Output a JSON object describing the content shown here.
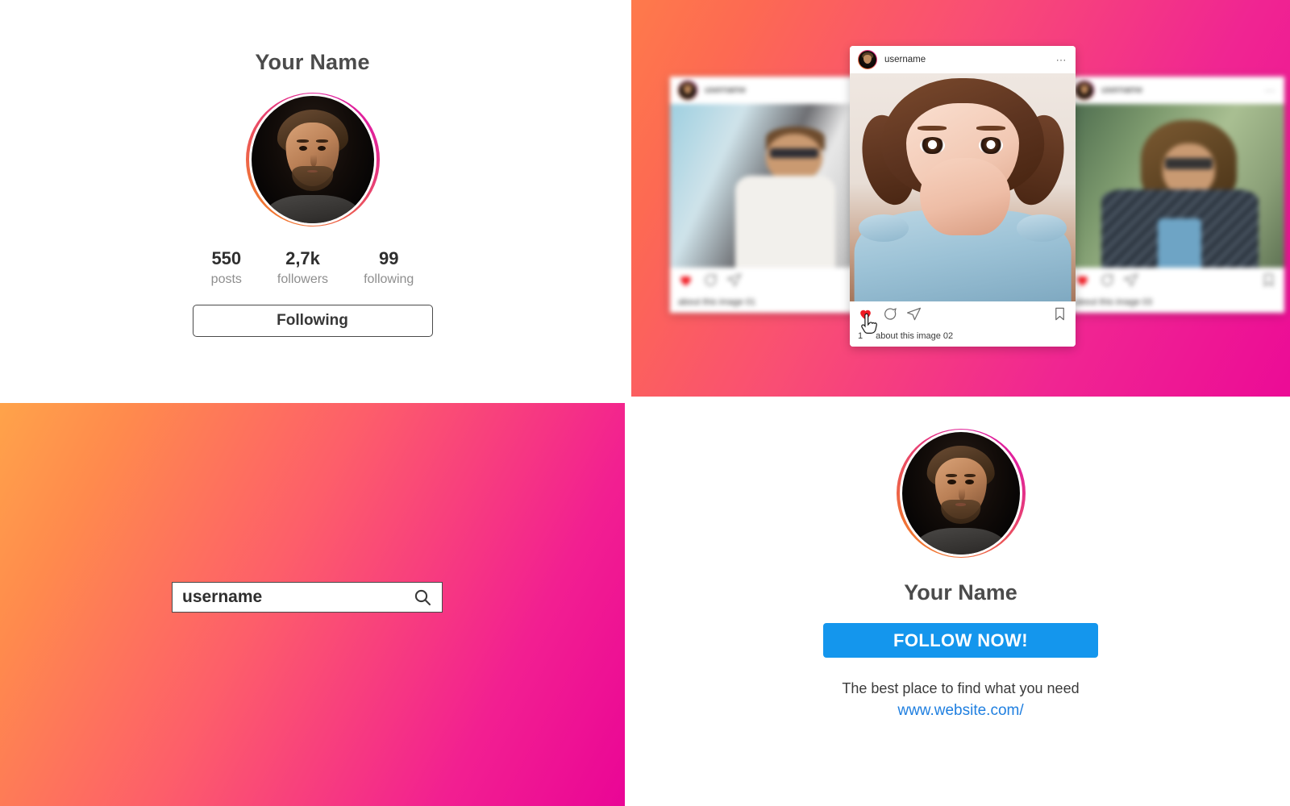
{
  "profile_panel": {
    "heading": "Your Name",
    "avatar_alt": "profile-photo",
    "stats": [
      {
        "value": "550",
        "label": "posts"
      },
      {
        "value": "2,7k",
        "label": "followers"
      },
      {
        "value": "99",
        "label": "following"
      }
    ],
    "follow_button_label": "Following"
  },
  "feed_panel": {
    "background_gradient": [
      "#fe7a4b",
      "#ec0b96"
    ],
    "posts": [
      {
        "id": "post-left",
        "username": "username",
        "caption": "about this image 01",
        "more_icon": "ellipsis-icon",
        "blurred": true
      },
      {
        "id": "post-front",
        "username": "username",
        "caption": "about this image 02",
        "caption_prefix": "1",
        "more_icon": "ellipsis-icon",
        "liked": true,
        "blurred": false,
        "actions": [
          "heart-icon",
          "comment-icon",
          "share-icon",
          "bookmark-icon"
        ],
        "cursor": "pointer-hand-cursor"
      },
      {
        "id": "post-right",
        "username": "username",
        "caption": "about this image 03",
        "more_icon": "ellipsis-icon",
        "blurred": true
      }
    ]
  },
  "search_panel": {
    "background_gradient": [
      "#ffa34a",
      "#ea0596"
    ],
    "input_value": "username",
    "input_placeholder": "username",
    "search_icon": "magnifier-icon"
  },
  "cta_panel": {
    "avatar_alt": "profile-photo",
    "name": "Your Name",
    "button_label": "FOLLOW NOW!",
    "button_color": "#1496ed",
    "tagline": "The best place to find what you need",
    "website": "www.website.com/",
    "link_color": "#1f7fe0"
  },
  "theme": {
    "ring_gradient": [
      "#f58529",
      "#dc1e9c"
    ],
    "heading_color": "#4b4b4b",
    "muted_text_color": "#8e8e8e",
    "heart_color": "#ed1c24"
  }
}
